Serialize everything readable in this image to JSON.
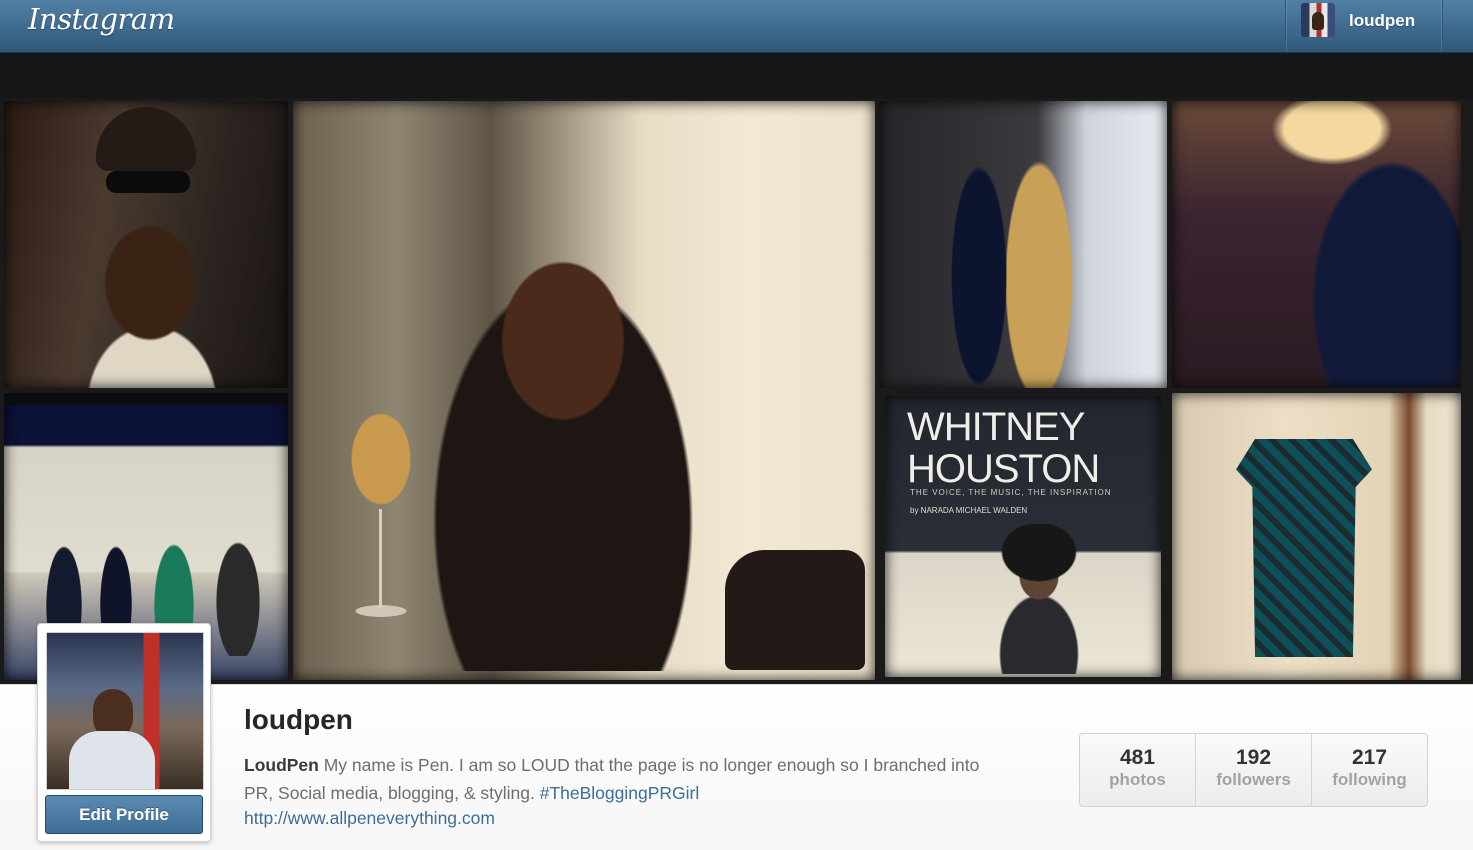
{
  "nav": {
    "logo": "Instagram",
    "username": "loudpen"
  },
  "cover": {
    "book_title_line1": "WHITNEY",
    "book_title_line2": "HOUSTON",
    "book_subtitle": "THE VOICE, THE MUSIC, THE INSPIRATION",
    "book_author": "by NARADA MICHAEL WALDEN"
  },
  "profile": {
    "username": "loudpen",
    "edit_label": "Edit Profile",
    "bio_name": "LoudPen",
    "bio_text": " My name is Pen. I am so LOUD that the page is no longer enough so I branched into PR, Social media, blogging, & styling. ",
    "bio_hashtag": "#TheBloggingPRGirl",
    "website": "http://www.allpeneverything.com"
  },
  "stats": [
    {
      "value": "481",
      "label": "photos"
    },
    {
      "value": "192",
      "label": "followers"
    },
    {
      "value": "217",
      "label": "following"
    }
  ]
}
